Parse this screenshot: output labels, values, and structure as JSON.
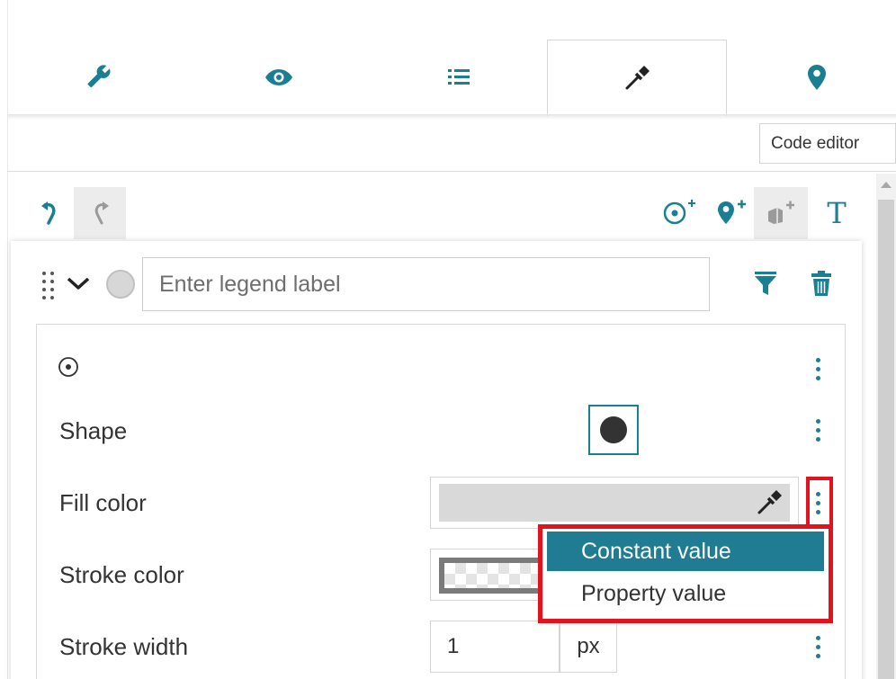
{
  "tabs": [
    {
      "icon": "wrench-icon",
      "active": false
    },
    {
      "icon": "eye-icon",
      "active": false
    },
    {
      "icon": "list-icon",
      "active": false
    },
    {
      "icon": "eyedropper-icon",
      "active": true
    },
    {
      "icon": "map-pin-icon",
      "active": false
    }
  ],
  "tooltip": "Code editor",
  "toolbar": {
    "icons": [
      "undo-icon",
      "redo-icon",
      "add-point-icon",
      "add-marker-icon",
      "add-polygon-icon",
      "add-text-icon"
    ],
    "text_icon_glyph": "T"
  },
  "legend": {
    "placeholder": "Enter legend label",
    "value": ""
  },
  "symbol": {
    "type_icon": "point-symbol-icon",
    "rows": {
      "shape_label": "Shape",
      "fill_label": "Fill color",
      "stroke_label": "Stroke color",
      "width_label": "Stroke width",
      "width_value": "1",
      "width_unit": "px"
    }
  },
  "dropdown": {
    "options": [
      "Constant value",
      "Property value"
    ],
    "selected": "Constant value"
  },
  "colors": {
    "accent": "#1b7f94",
    "selected_option_bg": "#1f7c92",
    "highlight": "#e3121f",
    "fill_value": "#d9d9d9",
    "shape_fill": "#333333"
  }
}
